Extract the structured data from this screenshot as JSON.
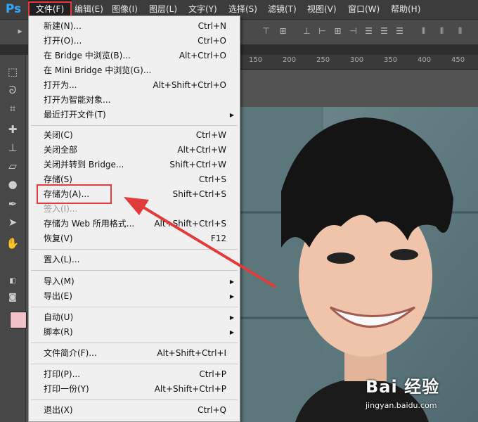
{
  "app": {
    "logo": "Ps"
  },
  "menubar": {
    "items": [
      "文件(F)",
      "编辑(E)",
      "图像(I)",
      "图层(L)",
      "文字(Y)",
      "选择(S)",
      "滤镜(T)",
      "视图(V)",
      "窗口(W)",
      "帮助(H)"
    ]
  },
  "file_menu": {
    "items": [
      {
        "label": "新建(N)...",
        "shortcut": "Ctrl+N"
      },
      {
        "label": "打开(O)...",
        "shortcut": "Ctrl+O"
      },
      {
        "label": "在 Bridge 中浏览(B)...",
        "shortcut": "Alt+Ctrl+O"
      },
      {
        "label": "在 Mini Bridge 中浏览(G)...",
        "shortcut": ""
      },
      {
        "label": "打开为...",
        "shortcut": "Alt+Shift+Ctrl+O"
      },
      {
        "label": "打开为智能对象...",
        "shortcut": ""
      },
      {
        "label": "最近打开文件(T)",
        "shortcut": ""
      },
      {
        "label": "关闭(C)",
        "shortcut": "Ctrl+W"
      },
      {
        "label": "关闭全部",
        "shortcut": "Alt+Ctrl+W"
      },
      {
        "label": "关闭并转到 Bridge...",
        "shortcut": "Shift+Ctrl+W"
      },
      {
        "label": "存储(S)",
        "shortcut": "Ctrl+S"
      },
      {
        "label": "存储为(A)...",
        "shortcut": "Shift+Ctrl+S"
      },
      {
        "label": "签入(I)...",
        "shortcut": ""
      },
      {
        "label": "存储为 Web 所用格式...",
        "shortcut": "Alt+Shift+Ctrl+S"
      },
      {
        "label": "恢复(V)",
        "shortcut": "F12"
      },
      {
        "label": "置入(L)...",
        "shortcut": ""
      },
      {
        "label": "导入(M)",
        "shortcut": ""
      },
      {
        "label": "导出(E)",
        "shortcut": ""
      },
      {
        "label": "自动(U)",
        "shortcut": ""
      },
      {
        "label": "脚本(R)",
        "shortcut": ""
      },
      {
        "label": "文件简介(F)...",
        "shortcut": "Alt+Shift+Ctrl+I"
      },
      {
        "label": "打印(P)...",
        "shortcut": "Ctrl+P"
      },
      {
        "label": "打印一份(Y)",
        "shortcut": "Alt+Shift+Ctrl+P"
      },
      {
        "label": "退出(X)",
        "shortcut": "Ctrl+Q"
      }
    ]
  },
  "ruler": {
    "labels": [
      "150",
      "200",
      "250",
      "300",
      "350",
      "400",
      "450"
    ]
  },
  "watermark": {
    "logo": "Bai 经验",
    "url": "jingyan.baidu.com"
  },
  "colors": {
    "highlight_box": "#e23b3b",
    "foreground_swatch": "#f2c1c8",
    "menu_bg": "#f0f0f0"
  }
}
